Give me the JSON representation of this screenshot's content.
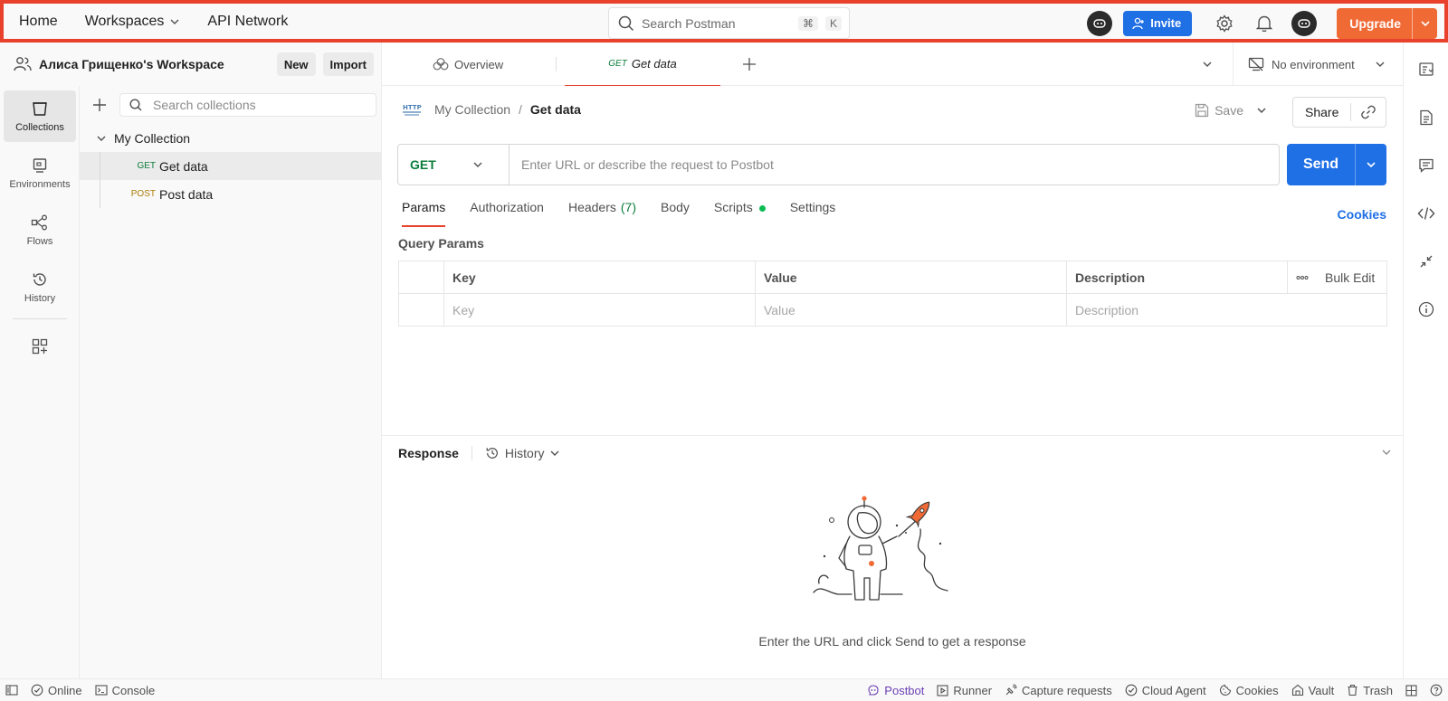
{
  "topbar": {
    "nav": [
      {
        "label": "Home"
      },
      {
        "label": "Workspaces"
      },
      {
        "label": "API Network"
      }
    ],
    "search": {
      "placeholder": "Search Postman",
      "shortcut_mod": "⌘",
      "shortcut_key": "K"
    },
    "invite_label": "Invite",
    "upgrade_label": "Upgrade"
  },
  "workspace": {
    "title": "Алиса Грищенко's Workspace",
    "new_label": "New",
    "import_label": "Import"
  },
  "rail": {
    "items": [
      {
        "label": "Collections"
      },
      {
        "label": "Environments"
      },
      {
        "label": "Flows"
      },
      {
        "label": "History"
      }
    ]
  },
  "sidebar": {
    "search_placeholder": "Search collections",
    "collection": {
      "name": "My Collection"
    },
    "requests": [
      {
        "method": "GET",
        "name": "Get data"
      },
      {
        "method": "POST",
        "name": "Post data"
      }
    ]
  },
  "tabs": {
    "overview_label": "Overview",
    "active": {
      "method": "GET",
      "name": "Get data"
    },
    "environment": "No environment"
  },
  "request": {
    "breadcrumb": {
      "collection": "My Collection",
      "separator": "/",
      "name": "Get data"
    },
    "save_label": "Save",
    "share_label": "Share",
    "method": "GET",
    "url_placeholder": "Enter URL or describe the request to Postbot",
    "send_label": "Send",
    "tabs": [
      {
        "label": "Params"
      },
      {
        "label": "Authorization"
      },
      {
        "label": "Headers",
        "count": "(7)"
      },
      {
        "label": "Body"
      },
      {
        "label": "Scripts"
      },
      {
        "label": "Settings"
      }
    ],
    "cookies_label": "Cookies",
    "query_params_title": "Query Params",
    "table": {
      "headers": [
        "Key",
        "Value",
        "Description"
      ],
      "bulk_edit_label": "Bulk Edit",
      "placeholders": [
        "Key",
        "Value",
        "Description"
      ]
    }
  },
  "response": {
    "title": "Response",
    "history_label": "History",
    "empty_message": "Enter the URL and click Send to get a response"
  },
  "statusbar": {
    "left": [
      {
        "label": "Online"
      },
      {
        "label": "Console"
      }
    ],
    "right": [
      {
        "label": "Postbot"
      },
      {
        "label": "Runner"
      },
      {
        "label": "Capture requests"
      },
      {
        "label": "Cloud Agent"
      },
      {
        "label": "Cookies"
      },
      {
        "label": "Vault"
      },
      {
        "label": "Trash"
      }
    ]
  },
  "colors": {
    "accent_orange": "#f06a35",
    "primary_blue": "#1f6fe5",
    "get_green": "#0c7d3c",
    "post_amber": "#ad7a03",
    "highlight_red": "#e8412c"
  }
}
